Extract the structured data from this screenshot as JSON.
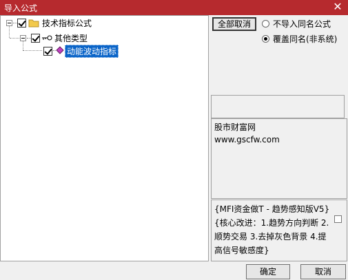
{
  "window": {
    "title": "导入公式",
    "close_glyph": "✕"
  },
  "tree": {
    "root": {
      "label": "技术指标公式",
      "checked": true,
      "icon": "folder-icon"
    },
    "child": {
      "label": "其他类型",
      "checked": true,
      "icon": "key-icon"
    },
    "leaf": {
      "label": "动能波动指标",
      "checked": true,
      "icon": "formula-diamond-icon",
      "selected": true
    }
  },
  "options": {
    "uncheck_all_label": "全部取消",
    "radio_skip_label": "不导入同名公式",
    "radio_overwrite_label": "覆盖同名(非系统)",
    "selected": "overwrite"
  },
  "info_panel": {
    "line1": "股市财富网",
    "line2": "www.gscfw.com"
  },
  "description": {
    "text": "{MFI资金做T - 趋势感知版V5}\n{核心改进：1.趋势方向判断 2.\n顺势交易 3.去掉灰色背景 4.提\n高信号敏感度}"
  },
  "footer": {
    "ok_label": "确定",
    "cancel_label": "取消"
  },
  "colors": {
    "title_bg": "#b62a2e",
    "selection": "#0a64c8",
    "folder": "#f2c94c"
  }
}
